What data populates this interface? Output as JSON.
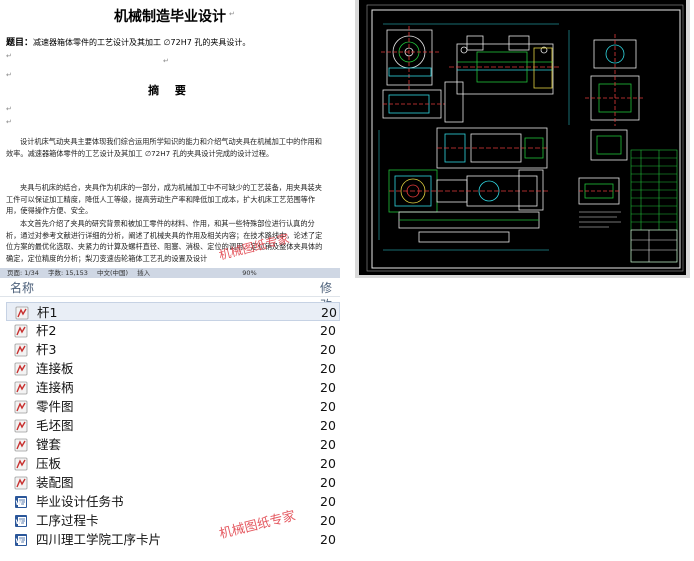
{
  "document": {
    "title": "机械制造毕业设计",
    "topic_label": "题目：",
    "topic_text": "减速器箱体零件的工艺设计及其加工 ∅72H7 孔的夹具设计。",
    "abstract_heading": "摘  要",
    "paragraphs": [
      "设计机床气动夹具主要体现我们综合运用所学知识的能力和介绍气动夹具在机械加工中的作用和效率。减速器箱体零件的工艺设计及其加工 ∅72H7 孔的夹具设计完成的设计过程。",
      "夹具与机床的结合，夹具作为机床的一部分，成为机械加工中不可缺少的工艺装备，用夹具装夹工件可以保证加工精度，降低人工等级，提高劳动生产率和降低加工成本，扩大机床工艺范围等作用，使得操作方便、安全。",
      "本文首先介绍了夹具的研究背景和被加工零件的材料、作用，和其一些特殊部位进行认真的分析，通过对参考文献进行详细的分析，阐述了机械夹具的作用及相关内容；在技术路线中，论述了定位方案的最优化选取、夹紧力的计算及螺杆直径、阻塞、消极、定位的调用、定位销及整体夹具体的确定，定位精度的分析；梨刀变速齿轮箱体工艺孔的设置及设计"
    ],
    "status": [
      "页面: 1/34",
      "字数: 15,153",
      "中文(中国)",
      "插入",
      "90%"
    ]
  },
  "file_list": {
    "header_name": "名称",
    "header_modified": "修改",
    "items": [
      {
        "name": "杆1",
        "date": "20",
        "icon": "drawing-file-icon",
        "selected": true
      },
      {
        "name": "杆2",
        "date": "20",
        "icon": "drawing-file-icon",
        "selected": false
      },
      {
        "name": "杆3",
        "date": "20",
        "icon": "drawing-file-icon",
        "selected": false
      },
      {
        "name": "连接板",
        "date": "20",
        "icon": "drawing-file-icon",
        "selected": false
      },
      {
        "name": "连接柄",
        "date": "20",
        "icon": "drawing-file-icon",
        "selected": false
      },
      {
        "name": "零件图",
        "date": "20",
        "icon": "drawing-file-icon",
        "selected": false
      },
      {
        "name": "毛坯图",
        "date": "20",
        "icon": "drawing-file-icon",
        "selected": false
      },
      {
        "name": "镗套",
        "date": "20",
        "icon": "drawing-file-icon",
        "selected": false
      },
      {
        "name": "压板",
        "date": "20",
        "icon": "drawing-file-icon",
        "selected": false
      },
      {
        "name": "装配图",
        "date": "20",
        "icon": "drawing-file-icon",
        "selected": false
      },
      {
        "name": "毕业设计任务书",
        "date": "20",
        "icon": "word-file-icon",
        "selected": false
      },
      {
        "name": "工序过程卡",
        "date": "20",
        "icon": "word-file-icon",
        "selected": false
      },
      {
        "name": "四川理工学院工序卡片",
        "date": "20",
        "icon": "word-file-icon",
        "selected": false
      }
    ]
  },
  "watermarks": [
    "机械图纸专家",
    "机械图纸专家"
  ],
  "colors": {
    "cad_background": "#000000",
    "cad_line": "#e8e8e8",
    "cad_green": "#21c23a",
    "cad_cyan": "#30d6e0",
    "cad_red": "#e23a3a",
    "cad_yellow": "#e0d040",
    "watermark": "#e2474f"
  }
}
